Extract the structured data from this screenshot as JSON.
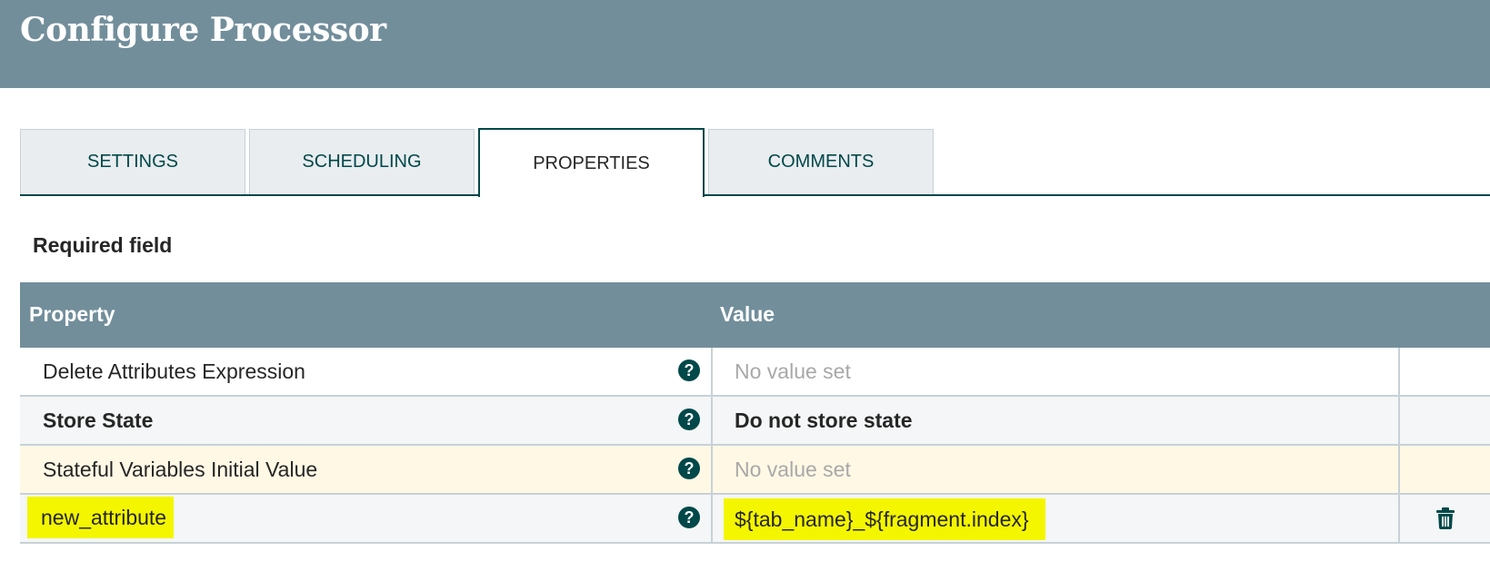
{
  "header": {
    "title": "Configure Processor"
  },
  "tabs": [
    {
      "label": "SETTINGS",
      "active": false
    },
    {
      "label": "SCHEDULING",
      "active": false
    },
    {
      "label": "PROPERTIES",
      "active": true
    },
    {
      "label": "COMMENTS",
      "active": false
    }
  ],
  "required_label": "Required field",
  "table": {
    "columns": {
      "property": "Property",
      "value": "Value"
    },
    "rows": [
      {
        "property": "Delete Attributes Expression",
        "value": "No value set",
        "required": false,
        "value_set": false,
        "help_icon": "help-icon"
      },
      {
        "property": "Store State",
        "value": "Do not store state",
        "required": true,
        "value_set": true,
        "help_icon": "help-icon"
      },
      {
        "property": "Stateful Variables Initial Value",
        "value": "No value set",
        "required": false,
        "value_set": false,
        "help_icon": "help-icon"
      },
      {
        "property": "new_attribute",
        "value": "${tab_name}_${fragment.index}",
        "required": false,
        "value_set": true,
        "help_icon": "help-icon",
        "action_icon": "trash-icon",
        "highlighted": true
      }
    ]
  },
  "colors": {
    "header_bg": "#728e9b",
    "accent": "#004849",
    "highlight": "#f4f600",
    "unset_text": "#a8a8a8"
  }
}
